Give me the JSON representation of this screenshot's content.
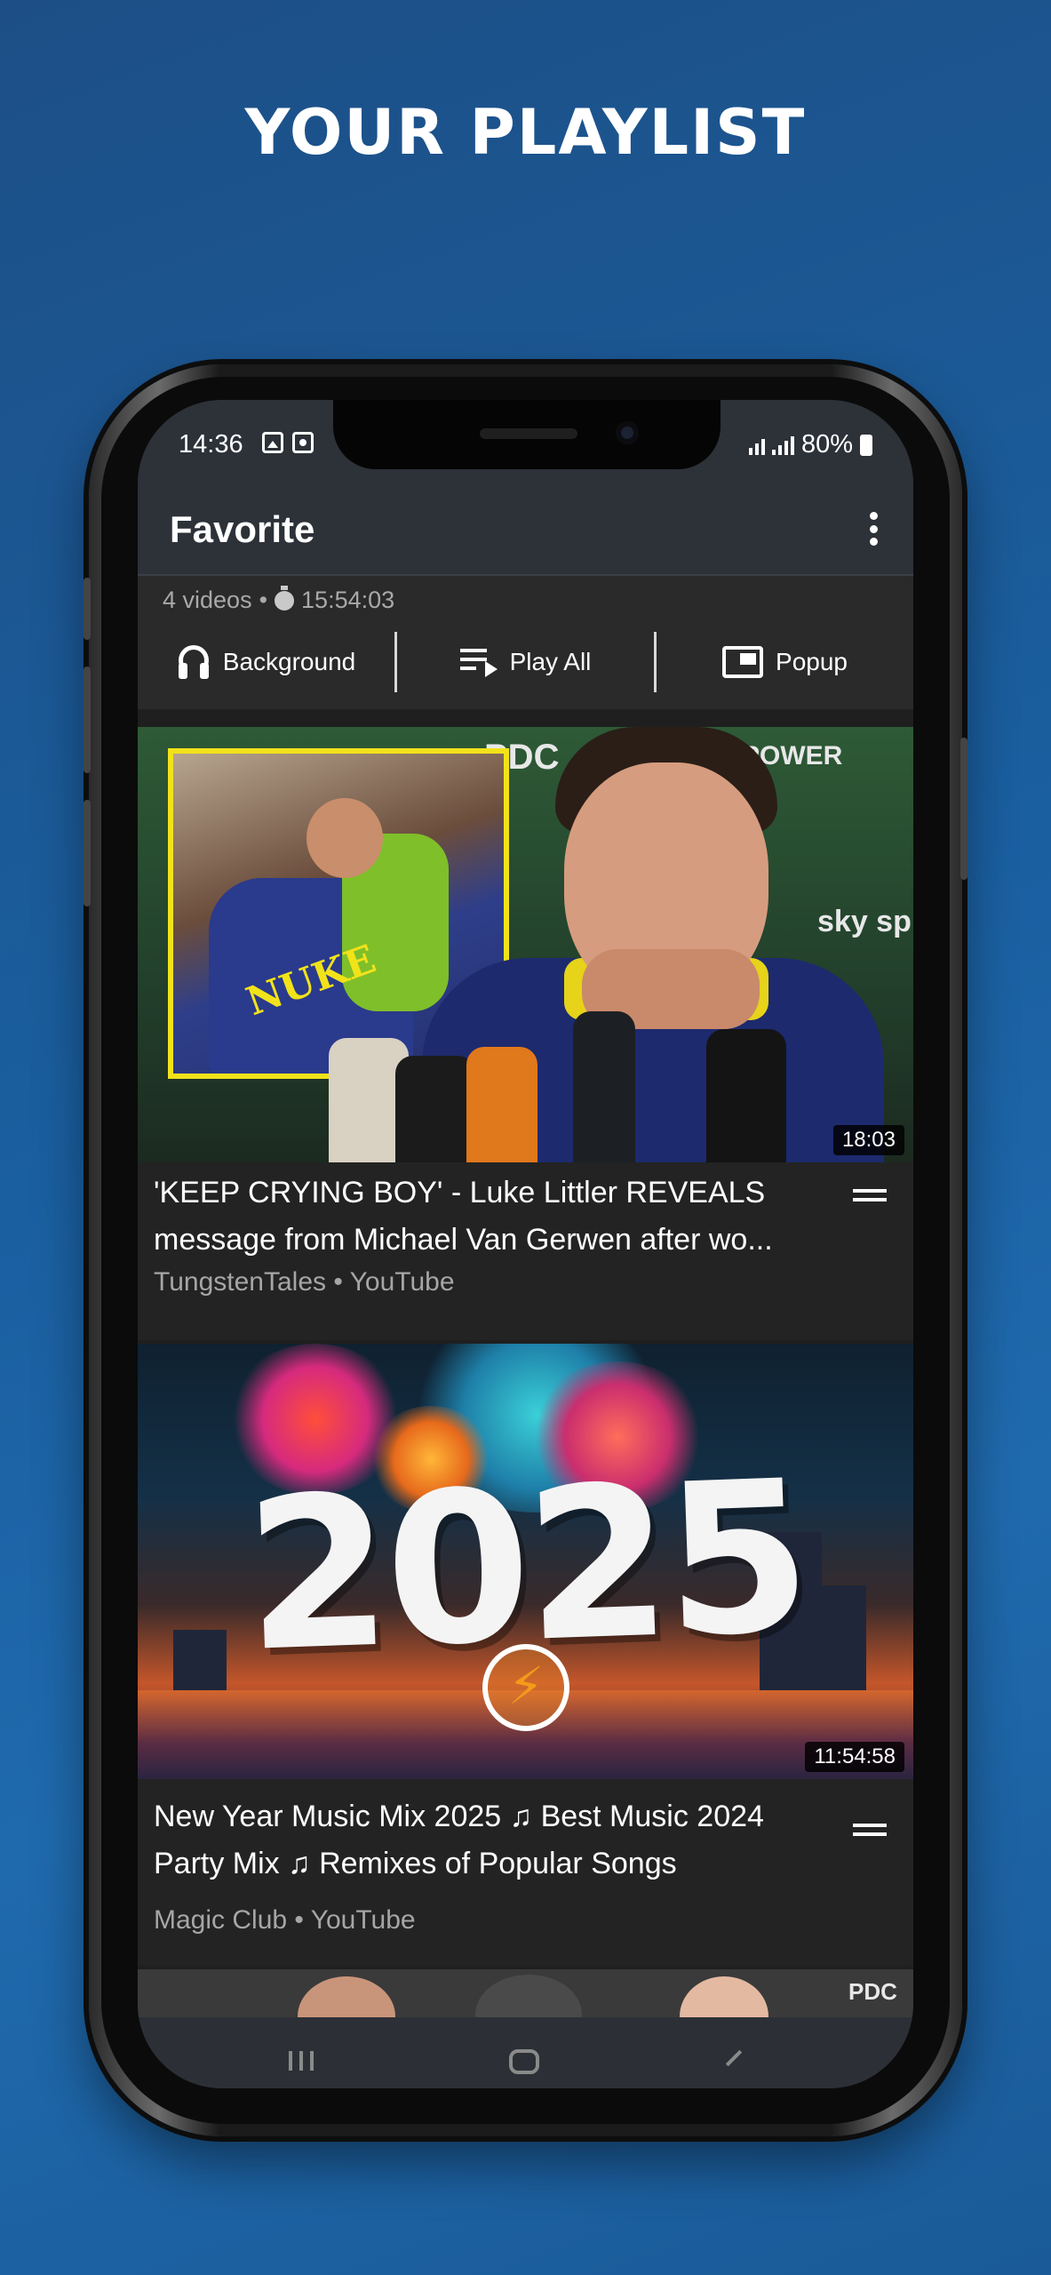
{
  "headline": "YOUR PLAYLIST",
  "status_bar": {
    "time": "14:36",
    "battery": "80%"
  },
  "app_bar": {
    "title": "Favorite"
  },
  "playlist_info": {
    "video_count": "4 videos",
    "separator": "•",
    "total_duration": "15:54:03"
  },
  "actions": [
    {
      "label": "Background",
      "icon": "headphones-icon"
    },
    {
      "label": "Play All",
      "icon": "play-queue-icon"
    },
    {
      "label": "Popup",
      "icon": "popup-window-icon"
    }
  ],
  "videos": [
    {
      "title": "'KEEP CRYING BOY' - Luke Littler REVEALS message from Michael Van Gerwen after wo...",
      "channel": "TungstenTales • YouTube",
      "duration": "18:03"
    },
    {
      "title": "New Year Music Mix 2025 ♫ Best Music 2024 Party Mix ♫ Remixes of Popular Songs",
      "channel": "Magic Club • YouTube",
      "duration": "11:54:58"
    }
  ],
  "thumbnail_text": {
    "year": "2025",
    "nuke": "NUKE",
    "pdc": "PDC",
    "sky": "sky sp",
    "power": "YPOWER"
  },
  "colors": {
    "background": "#1a5fa0",
    "app_bar": "#2d3138",
    "list_background": "#232323",
    "accent_yellow": "#f2e21a"
  }
}
